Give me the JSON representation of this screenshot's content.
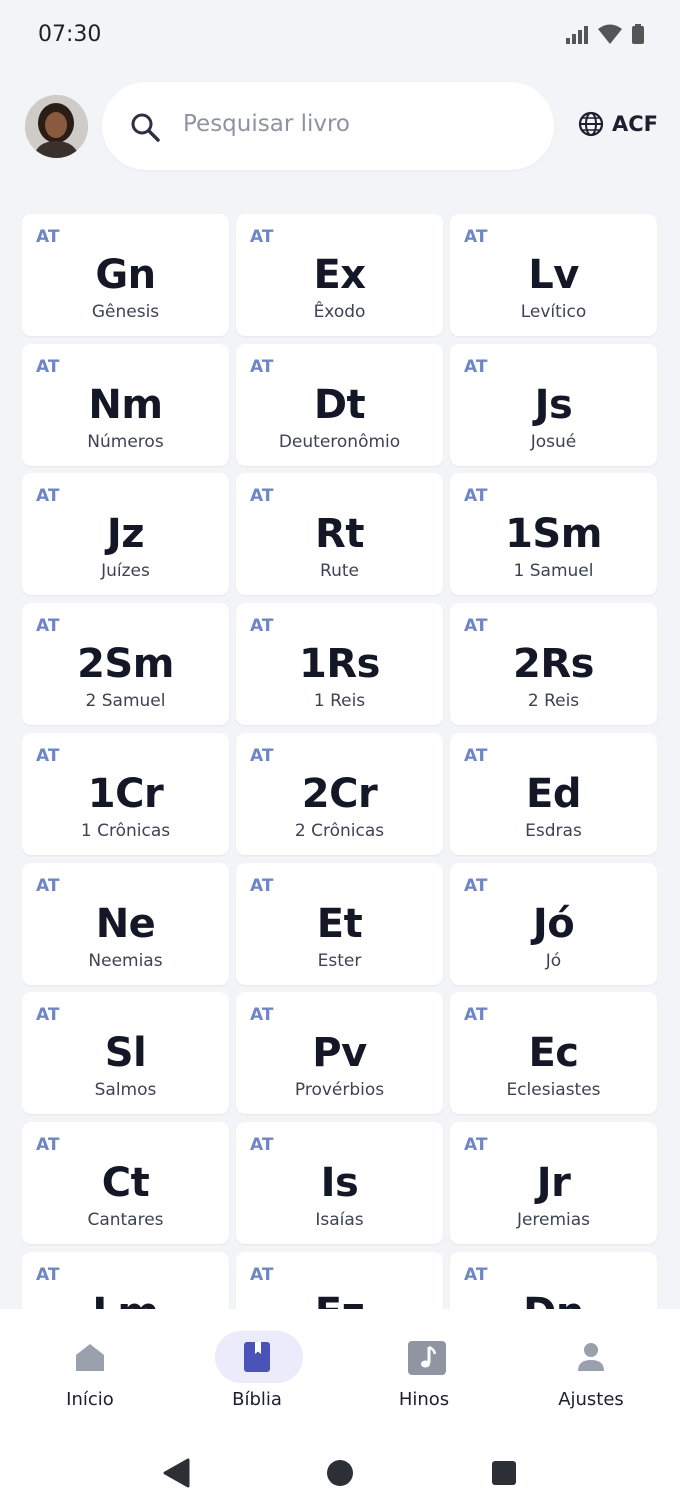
{
  "status": {
    "time": "07:30"
  },
  "search": {
    "placeholder": "Pesquisar livro"
  },
  "version": {
    "label": "ACF"
  },
  "books": [
    {
      "tag": "AT",
      "abbr": "Gn",
      "name": "Gênesis"
    },
    {
      "tag": "AT",
      "abbr": "Ex",
      "name": "Êxodo"
    },
    {
      "tag": "AT",
      "abbr": "Lv",
      "name": "Levítico"
    },
    {
      "tag": "AT",
      "abbr": "Nm",
      "name": "Números"
    },
    {
      "tag": "AT",
      "abbr": "Dt",
      "name": "Deuteronômio"
    },
    {
      "tag": "AT",
      "abbr": "Js",
      "name": "Josué"
    },
    {
      "tag": "AT",
      "abbr": "Jz",
      "name": "Juízes"
    },
    {
      "tag": "AT",
      "abbr": "Rt",
      "name": "Rute"
    },
    {
      "tag": "AT",
      "abbr": "1Sm",
      "name": "1 Samuel"
    },
    {
      "tag": "AT",
      "abbr": "2Sm",
      "name": "2 Samuel"
    },
    {
      "tag": "AT",
      "abbr": "1Rs",
      "name": "1 Reis"
    },
    {
      "tag": "AT",
      "abbr": "2Rs",
      "name": "2 Reis"
    },
    {
      "tag": "AT",
      "abbr": "1Cr",
      "name": "1 Crônicas"
    },
    {
      "tag": "AT",
      "abbr": "2Cr",
      "name": "2 Crônicas"
    },
    {
      "tag": "AT",
      "abbr": "Ed",
      "name": "Esdras"
    },
    {
      "tag": "AT",
      "abbr": "Ne",
      "name": "Neemias"
    },
    {
      "tag": "AT",
      "abbr": "Et",
      "name": "Ester"
    },
    {
      "tag": "AT",
      "abbr": "Jó",
      "name": "Jó"
    },
    {
      "tag": "AT",
      "abbr": "Sl",
      "name": "Salmos"
    },
    {
      "tag": "AT",
      "abbr": "Pv",
      "name": "Provérbios"
    },
    {
      "tag": "AT",
      "abbr": "Ec",
      "name": "Eclesiastes"
    },
    {
      "tag": "AT",
      "abbr": "Ct",
      "name": "Cantares"
    },
    {
      "tag": "AT",
      "abbr": "Is",
      "name": "Isaías"
    },
    {
      "tag": "AT",
      "abbr": "Jr",
      "name": "Jeremias"
    },
    {
      "tag": "AT",
      "abbr": "Lm",
      "name": ""
    },
    {
      "tag": "AT",
      "abbr": "Ez",
      "name": ""
    },
    {
      "tag": "AT",
      "abbr": "Dn",
      "name": ""
    }
  ],
  "nav": {
    "items": [
      {
        "label": "Início",
        "icon": "home-icon",
        "active": false
      },
      {
        "label": "Bíblia",
        "icon": "book-icon",
        "active": true
      },
      {
        "label": "Hinos",
        "icon": "music-icon",
        "active": false
      },
      {
        "label": "Ajustes",
        "icon": "person-icon",
        "active": false
      }
    ]
  },
  "colors": {
    "accent": "#4b52b8",
    "tag": "#6e86c6",
    "background": "#f3f4f7",
    "active_pill": "#ebebfb"
  }
}
